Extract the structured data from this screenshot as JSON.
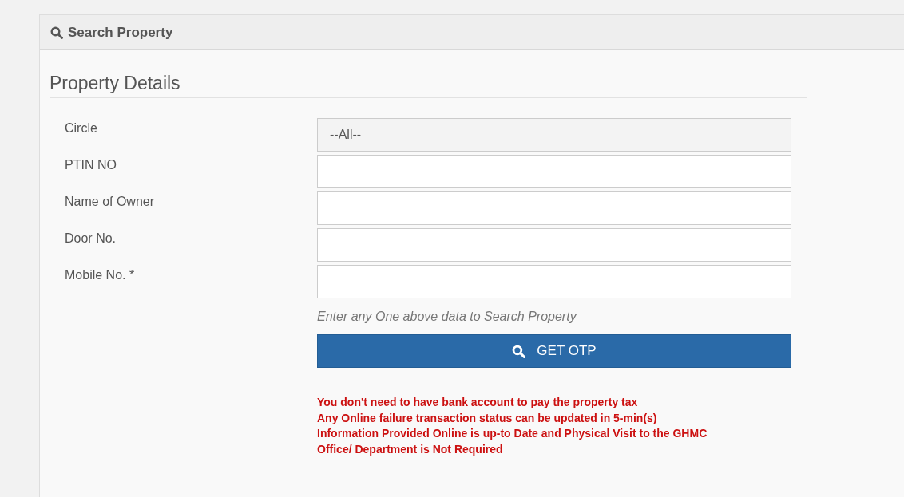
{
  "panel": {
    "title": "Search Property"
  },
  "section": {
    "title": "Property Details"
  },
  "fields": [
    {
      "label": "Circle",
      "kind": "select",
      "value": "--All--"
    },
    {
      "label": "PTIN NO",
      "kind": "text"
    },
    {
      "label": "Name of Owner",
      "kind": "text"
    },
    {
      "label": "Door No.",
      "kind": "text"
    },
    {
      "label": "Mobile No. *",
      "kind": "text"
    }
  ],
  "hint": "Enter any One above data to Search Property",
  "button": {
    "label": "GET OTP"
  },
  "notes": [
    "You don't need to have bank account to pay the property tax",
    "Any Online failure transaction status can be updated in 5-min(s)",
    "Information Provided Online is up-to Date and Physical Visit to the GHMC Office/ Department is Not Required"
  ]
}
